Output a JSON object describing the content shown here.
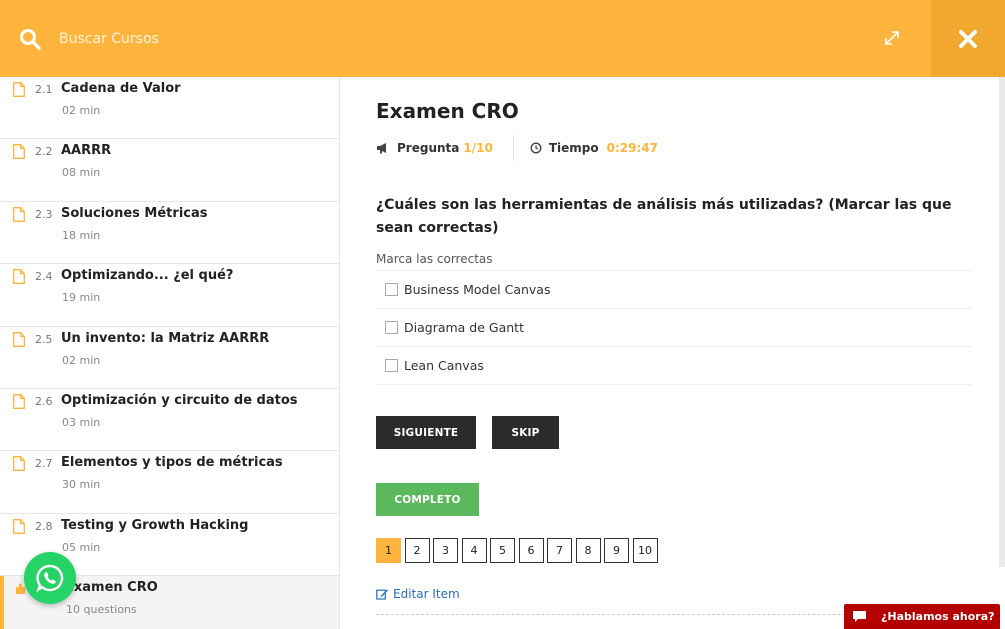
{
  "search": {
    "placeholder": "Buscar Cursos"
  },
  "sidebar": {
    "items": [
      {
        "number": "2.1",
        "title": "Cadena de Valor",
        "duration": "02 min"
      },
      {
        "number": "2.2",
        "title": "AARRR",
        "duration": "08 min"
      },
      {
        "number": "2.3",
        "title": "Soluciones Métricas",
        "duration": "18 min"
      },
      {
        "number": "2.4",
        "title": "Optimizando... ¿el qué?",
        "duration": "19 min"
      },
      {
        "number": "2.5",
        "title": "Un invento: la Matriz AARRR",
        "duration": "02 min"
      },
      {
        "number": "2.6",
        "title": "Optimización y circuito de datos",
        "duration": "03 min"
      },
      {
        "number": "2.7",
        "title": "Elementos y tipos de métricas",
        "duration": "30 min"
      },
      {
        "number": "2.8",
        "title": "Testing y Growth Hacking",
        "duration": "05 min"
      },
      {
        "number": "",
        "title": "Examen CRO",
        "duration": "10 questions"
      }
    ]
  },
  "exam": {
    "title": "Examen CRO",
    "question_label": "Pregunta",
    "question_value": "1/10",
    "time_label": "Tiempo",
    "time_value": "0:29:47",
    "question": "¿Cuáles son las herramientas de análisis más utilizadas? (Marcar las que sean correctas)",
    "hint": "Marca las correctas",
    "options": [
      "Business Model Canvas",
      "Diagrama de Gantt",
      "Lean Canvas"
    ],
    "next_label": "SIGUIENTE",
    "skip_label": "SKIP",
    "complete_label": "COMPLETO",
    "pages": [
      "1",
      "2",
      "3",
      "4",
      "5",
      "6",
      "7",
      "8",
      "9",
      "10"
    ],
    "current_page": "1",
    "edit_label": "Editar Item"
  },
  "chat": {
    "label": "¿Hablamos ahora?"
  },
  "colors": {
    "accent": "#ffb53d",
    "accent_dark": "#f2a72f",
    "complete": "#5cb85c",
    "chat": "#b40000",
    "whatsapp": "#25d366"
  }
}
